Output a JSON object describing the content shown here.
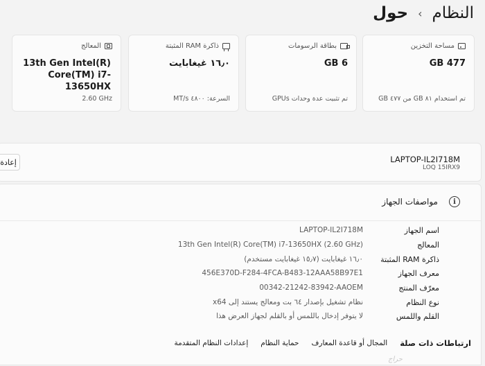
{
  "breadcrumb": {
    "parent": "النظام",
    "current": "حول"
  },
  "cards": [
    {
      "title": "مساحة التخزين",
      "icon": "storage-icon",
      "value": "477 GB",
      "foot": "تم استخدام ٨١ GB من ٤٧٧ GB"
    },
    {
      "title": "بطاقة الرسومات",
      "icon": "gpu-icon",
      "value": "6 GB",
      "foot": "تم تثبيت عدة وحدات GPUs"
    },
    {
      "title": "ذاكرة RAM المثبتة",
      "icon": "ram-icon",
      "value": "١٦٫٠ غيغابايت",
      "foot": "السرعة: ٤٨٠٠ MT/s"
    },
    {
      "title": "المعالج",
      "icon": "cpu-icon",
      "value": "13th Gen Intel(R) Core(TM) i7-13650HX",
      "foot": "2.60 GHz"
    }
  ],
  "device": {
    "name": "LAPTOP-IL2I718M",
    "model": "LOQ 15IRX9",
    "rename_label": "إعادة"
  },
  "specs": {
    "title": "مواصفات الجهاز",
    "rows": [
      {
        "label": "اسم الجهاز",
        "value": "LAPTOP-IL2I718M"
      },
      {
        "label": "المعالج",
        "value": "13th Gen Intel(R) Core(TM) i7-13650HX (2.60 GHz)"
      },
      {
        "label": "ذاكرة RAM المثبتة",
        "value": "١٦٫٠ غيغابايت (١٥٫٧ غيغابايت مستخدم)"
      },
      {
        "label": "معرف الجهاز",
        "value": "456E370D-F284-4FCA-B483-12AAA58B97E1"
      },
      {
        "label": "معرّف المنتج",
        "value": "00342-21242-83942-AAOEM"
      },
      {
        "label": "نوع النظام",
        "value": "نظام تشغيل بإصدار ٦٤ بت ومعالج يستند إلى x64"
      },
      {
        "label": "القلم واللمس",
        "value": "لا يتوفر إدخال باللمس أو بالقلم لجهاز العرض هذا"
      }
    ]
  },
  "related": {
    "title": "ارتباطات ذات صلة",
    "links": [
      "المجال أو قاعدة المعارف",
      "حماية النظام",
      "إعدادات النظام المتقدمة"
    ]
  },
  "watermark": "حراج"
}
